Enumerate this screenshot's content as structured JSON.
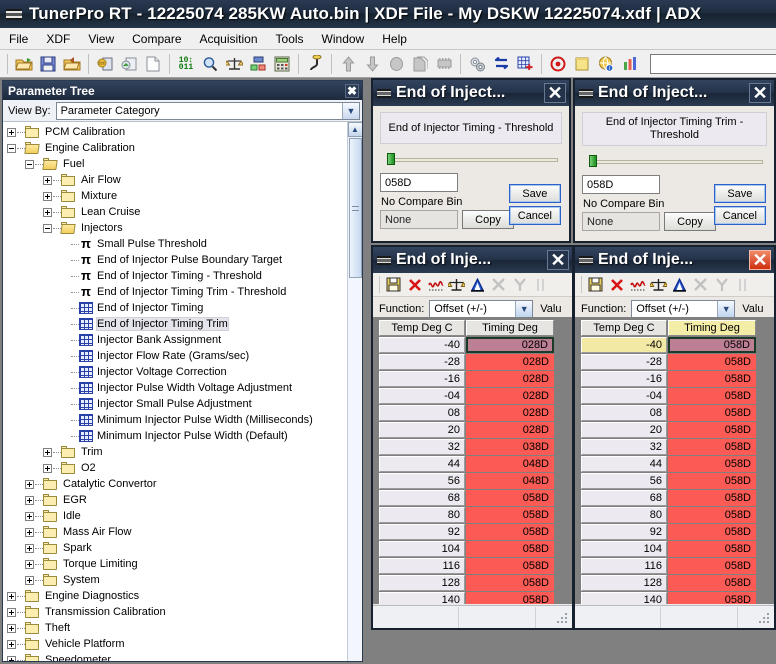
{
  "titlebar": {
    "icon": "chip-icon",
    "text": "TunerPro RT - 12225074 285KW Auto.bin  |  XDF File - My DSKW  12225074.xdf  |  ADX"
  },
  "menubar": {
    "items": [
      "File",
      "XDF",
      "View",
      "Compare",
      "Acquisition",
      "Tools",
      "Window",
      "Help"
    ]
  },
  "toolbar": {
    "icons": [
      "open-folder-icon",
      "save-disk-icon",
      "open-bin-icon",
      "open-xdf-icon",
      "save-xdf-icon",
      "new-file-icon",
      "hex-editor-icon",
      "find-icon",
      "compare-scales-icon",
      "tree-view-icon",
      "calculator-icon",
      "hook-icon",
      "upload-arrow-icon",
      "download-arrow-icon",
      "ellipse-icon",
      "copy-pages-icon",
      "chip-flash-icon",
      "gears-icon",
      "swap-arrows-icon",
      "grid-plus-icon",
      "record-icon",
      "notes-icon",
      "globe-info-icon",
      "chart-bars-icon"
    ],
    "search_value": ""
  },
  "parameter_tree": {
    "title": "Parameter Tree",
    "close_label": "✖",
    "view_by_label": "View By:",
    "view_by_value": "Parameter Category",
    "rows": [
      {
        "label": "PCM Calibration",
        "depth": 0,
        "icon": "folder-closed-icon",
        "toggle": "plus"
      },
      {
        "label": "Engine Calibration",
        "depth": 0,
        "icon": "folder-open-icon",
        "toggle": "minus"
      },
      {
        "label": "Fuel",
        "depth": 1,
        "icon": "folder-open-icon",
        "toggle": "minus"
      },
      {
        "label": "Air Flow",
        "depth": 2,
        "icon": "folder-closed-icon",
        "toggle": "plus"
      },
      {
        "label": "Mixture",
        "depth": 2,
        "icon": "folder-closed-icon",
        "toggle": "plus"
      },
      {
        "label": "Lean Cruise",
        "depth": 2,
        "icon": "folder-closed-icon",
        "toggle": "plus"
      },
      {
        "label": "Injectors",
        "depth": 2,
        "icon": "folder-open-icon",
        "toggle": "minus"
      },
      {
        "label": "Small Pulse Threshold",
        "depth": 3,
        "icon": "constant-pi-icon",
        "toggle": "none"
      },
      {
        "label": "End of Injector Pulse Boundary Target",
        "depth": 3,
        "icon": "constant-pi-icon",
        "toggle": "none"
      },
      {
        "label": "End of Injector Timing - Threshold",
        "depth": 3,
        "icon": "constant-pi-icon",
        "toggle": "none"
      },
      {
        "label": "End of Injector Timing Trim - Threshold",
        "depth": 3,
        "icon": "constant-pi-icon",
        "toggle": "none"
      },
      {
        "label": "End of Injector Timing",
        "depth": 3,
        "icon": "table-grid-icon",
        "toggle": "none"
      },
      {
        "label": "End of Injector Timing Trim",
        "depth": 3,
        "icon": "table-grid-icon",
        "toggle": "none",
        "selected": true
      },
      {
        "label": "Injector Bank Assignment",
        "depth": 3,
        "icon": "table-grid-icon",
        "toggle": "none"
      },
      {
        "label": "Injector Flow Rate (Grams/sec)",
        "depth": 3,
        "icon": "table-grid-icon",
        "toggle": "none"
      },
      {
        "label": "Injector Voltage Correction",
        "depth": 3,
        "icon": "table-grid-icon",
        "toggle": "none"
      },
      {
        "label": "Injector Pulse Width Voltage Adjustment",
        "depth": 3,
        "icon": "table-grid-icon",
        "toggle": "none"
      },
      {
        "label": "Injector Small Pulse Adjustment",
        "depth": 3,
        "icon": "table-grid-icon",
        "toggle": "none"
      },
      {
        "label": "Minimum Injector Pulse Width (Milliseconds)",
        "depth": 3,
        "icon": "table-grid-icon",
        "toggle": "none"
      },
      {
        "label": "Minimum Injector Pulse Width (Default)",
        "depth": 3,
        "icon": "table-grid-icon",
        "toggle": "none"
      },
      {
        "label": "Trim",
        "depth": 2,
        "icon": "folder-closed-icon",
        "toggle": "plus"
      },
      {
        "label": "O2",
        "depth": 2,
        "icon": "folder-closed-icon",
        "toggle": "plus"
      },
      {
        "label": "Catalytic Convertor",
        "depth": 1,
        "icon": "folder-closed-icon",
        "toggle": "plus"
      },
      {
        "label": "EGR",
        "depth": 1,
        "icon": "folder-closed-icon",
        "toggle": "plus"
      },
      {
        "label": "Idle",
        "depth": 1,
        "icon": "folder-closed-icon",
        "toggle": "plus"
      },
      {
        "label": "Mass Air Flow",
        "depth": 1,
        "icon": "folder-closed-icon",
        "toggle": "plus"
      },
      {
        "label": "Spark",
        "depth": 1,
        "icon": "folder-closed-icon",
        "toggle": "plus"
      },
      {
        "label": "Torque Limiting",
        "depth": 1,
        "icon": "folder-closed-icon",
        "toggle": "plus"
      },
      {
        "label": "System",
        "depth": 1,
        "icon": "folder-closed-icon",
        "toggle": "plus"
      },
      {
        "label": "Engine Diagnostics",
        "depth": 0,
        "icon": "folder-closed-icon",
        "toggle": "plus"
      },
      {
        "label": "Transmission Calibration",
        "depth": 0,
        "icon": "folder-closed-icon",
        "toggle": "plus"
      },
      {
        "label": "Theft",
        "depth": 0,
        "icon": "folder-closed-icon",
        "toggle": "plus"
      },
      {
        "label": "Vehicle Platform",
        "depth": 0,
        "icon": "folder-closed-icon",
        "toggle": "plus"
      },
      {
        "label": "Speedometer",
        "depth": 0,
        "icon": "folder-closed-icon",
        "toggle": "plus"
      }
    ]
  },
  "threshold_window_1": {
    "title": "End of Inject...",
    "close_label": "✕",
    "param_name": "End of Injector Timing - Threshold",
    "value": "058D",
    "compare_label": "No Compare Bin",
    "compare_value": "None",
    "copy_label": "Copy",
    "save_label": "Save",
    "cancel_label": "Cancel"
  },
  "threshold_window_2": {
    "title": "End of Inject...",
    "close_label": "✕",
    "param_name": "End of Injector Timing Trim - Threshold",
    "value": "058D",
    "compare_label": "No Compare Bin",
    "compare_value": "None",
    "copy_label": "Copy",
    "save_label": "Save",
    "cancel_label": "Cancel"
  },
  "table_window_1": {
    "title": "End of Inje...",
    "close_label": "✕",
    "active": false,
    "toolbar_icons": [
      "save-table-icon",
      "close-red-x-icon",
      "graph-curve-icon",
      "scales-compare-icon",
      "delta-icon",
      "cut-disabled-icon",
      "merge-disabled-icon",
      "more-disabled-icon"
    ],
    "function_label": "Function:",
    "function_value": "Offset (+/-)",
    "value_label": "Valu",
    "columns": [
      "Temp Deg C",
      "Timing Deg"
    ],
    "rows": [
      {
        "axis": "-40",
        "value": "028D",
        "selected": true
      },
      {
        "axis": "-28",
        "value": "028D"
      },
      {
        "axis": "-16",
        "value": "028D"
      },
      {
        "axis": "-04",
        "value": "028D"
      },
      {
        "axis": "08",
        "value": "028D"
      },
      {
        "axis": "20",
        "value": "028D"
      },
      {
        "axis": "32",
        "value": "038D"
      },
      {
        "axis": "44",
        "value": "048D"
      },
      {
        "axis": "56",
        "value": "048D"
      },
      {
        "axis": "68",
        "value": "058D"
      },
      {
        "axis": "80",
        "value": "058D"
      },
      {
        "axis": "92",
        "value": "058D"
      },
      {
        "axis": "104",
        "value": "058D"
      },
      {
        "axis": "116",
        "value": "058D"
      },
      {
        "axis": "128",
        "value": "058D"
      },
      {
        "axis": "140",
        "value": "058D"
      }
    ]
  },
  "table_window_2": {
    "title": "End of Inje...",
    "close_label": "✕",
    "active": true,
    "toolbar_icons": [
      "save-table-icon",
      "close-red-x-icon",
      "graph-curve-icon",
      "scales-compare-icon",
      "delta-icon",
      "cut-disabled-icon",
      "merge-disabled-icon",
      "more-disabled-icon"
    ],
    "function_label": "Function:",
    "function_value": "Offset (+/-)",
    "value_label": "Valu",
    "columns": [
      "Temp Deg C",
      "Timing Deg"
    ],
    "rows": [
      {
        "axis": "-40",
        "value": "058D",
        "selected": true
      },
      {
        "axis": "-28",
        "value": "058D"
      },
      {
        "axis": "-16",
        "value": "058D"
      },
      {
        "axis": "-04",
        "value": "058D"
      },
      {
        "axis": "08",
        "value": "058D"
      },
      {
        "axis": "20",
        "value": "058D"
      },
      {
        "axis": "32",
        "value": "058D"
      },
      {
        "axis": "44",
        "value": "058D"
      },
      {
        "axis": "56",
        "value": "058D"
      },
      {
        "axis": "68",
        "value": "058D"
      },
      {
        "axis": "80",
        "value": "058D"
      },
      {
        "axis": "92",
        "value": "058D"
      },
      {
        "axis": "104",
        "value": "058D"
      },
      {
        "axis": "116",
        "value": "058D"
      },
      {
        "axis": "128",
        "value": "058D"
      },
      {
        "axis": "140",
        "value": "058D"
      }
    ]
  },
  "colors": {
    "titlebar_dark": "#1f2d42",
    "cell_red": "#fb5b54",
    "cell_selected": "#bd7f93",
    "axis_highlight": "#f2e9a4",
    "workspace_gray": "#808080"
  }
}
